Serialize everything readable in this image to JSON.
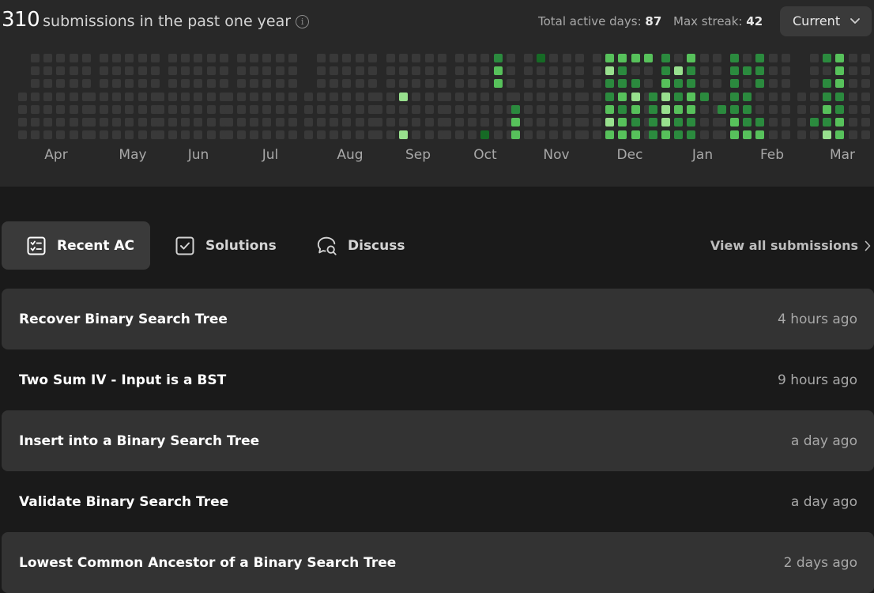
{
  "stats": {
    "count": "310",
    "count_label": "submissions in the past one year",
    "total_active_label": "Total active days:",
    "total_active_value": "87",
    "max_streak_label": "Max streak:",
    "max_streak_value": "42",
    "period_select": "Current"
  },
  "heatmap": {
    "months": [
      "Apr",
      "May",
      "Jun",
      "Jul",
      "Aug",
      "Sep",
      "Oct",
      "Nov",
      "Dec",
      "Jan",
      "Feb",
      "Mar"
    ],
    "colors": {
      "empty": "#393939",
      "level1": "#166a25",
      "level2": "#2b8a3e",
      "level3": "#57c15b",
      "level4": "#98e08e"
    },
    "active_cells": [
      {
        "month": "Sep",
        "week": 2,
        "day": 3,
        "level": 4
      },
      {
        "month": "Sep",
        "week": 2,
        "day": 6,
        "level": 4
      },
      {
        "month": "Oct",
        "week": 0,
        "day": 1,
        "level": 4
      },
      {
        "month": "Oct",
        "week": 0,
        "day": 2,
        "level": 4
      },
      {
        "month": "Oct",
        "week": 3,
        "day": 6,
        "level": 1
      },
      {
        "month": "Oct",
        "week": 4,
        "day": 0,
        "level": 2
      },
      {
        "month": "Oct",
        "week": 4,
        "day": 1,
        "level": 3
      },
      {
        "month": "Oct",
        "week": 4,
        "day": 2,
        "level": 3
      },
      {
        "month": "Nov",
        "week": 0,
        "day": 4,
        "level": 2
      },
      {
        "month": "Nov",
        "week": 0,
        "day": 5,
        "level": 3
      },
      {
        "month": "Nov",
        "week": 0,
        "day": 6,
        "level": 3
      },
      {
        "month": "Nov",
        "week": 2,
        "day": 0,
        "level": 1
      },
      {
        "month": "Dec",
        "week": 2,
        "day": 0,
        "level": 3
      },
      {
        "month": "Dec",
        "week": 2,
        "day": 1,
        "level": 4
      },
      {
        "month": "Dec",
        "week": 2,
        "day": 2,
        "level": 2
      },
      {
        "month": "Dec",
        "week": 2,
        "day": 3,
        "level": 2
      },
      {
        "month": "Dec",
        "week": 2,
        "day": 4,
        "level": 3
      },
      {
        "month": "Dec",
        "week": 2,
        "day": 5,
        "level": 4
      },
      {
        "month": "Dec",
        "week": 2,
        "day": 6,
        "level": 3
      },
      {
        "month": "Dec",
        "week": 3,
        "day": 0,
        "level": 3
      },
      {
        "month": "Dec",
        "week": 3,
        "day": 1,
        "level": 2
      },
      {
        "month": "Dec",
        "week": 3,
        "day": 2,
        "level": 2
      },
      {
        "month": "Dec",
        "week": 3,
        "day": 3,
        "level": 3
      },
      {
        "month": "Dec",
        "week": 3,
        "day": 4,
        "level": 2
      },
      {
        "month": "Dec",
        "week": 3,
        "day": 5,
        "level": 3
      },
      {
        "month": "Dec",
        "week": 3,
        "day": 6,
        "level": 3
      },
      {
        "month": "Dec",
        "week": 4,
        "day": 0,
        "level": 3
      },
      {
        "month": "Dec",
        "week": 4,
        "day": 2,
        "level": 2
      },
      {
        "month": "Dec",
        "week": 4,
        "day": 3,
        "level": 4
      },
      {
        "month": "Dec",
        "week": 4,
        "day": 4,
        "level": 3
      },
      {
        "month": "Dec",
        "week": 4,
        "day": 5,
        "level": 2
      },
      {
        "month": "Dec",
        "week": 4,
        "day": 6,
        "level": 3
      },
      {
        "month": "Dec",
        "week": 5,
        "day": 0,
        "level": 3
      },
      {
        "month": "Jan",
        "week": 0,
        "day": 2,
        "level": 3
      },
      {
        "month": "Jan",
        "week": 0,
        "day": 3,
        "level": 2
      },
      {
        "month": "Jan",
        "week": 0,
        "day": 4,
        "level": 2
      },
      {
        "month": "Jan",
        "week": 0,
        "day": 5,
        "level": 2
      },
      {
        "month": "Jan",
        "week": 0,
        "day": 6,
        "level": 2
      },
      {
        "month": "Jan",
        "week": 1,
        "day": 0,
        "level": 2
      },
      {
        "month": "Jan",
        "week": 1,
        "day": 1,
        "level": 2
      },
      {
        "month": "Jan",
        "week": 1,
        "day": 2,
        "level": 3
      },
      {
        "month": "Jan",
        "week": 1,
        "day": 3,
        "level": 4
      },
      {
        "month": "Jan",
        "week": 1,
        "day": 4,
        "level": 4
      },
      {
        "month": "Jan",
        "week": 1,
        "day": 5,
        "level": 4
      },
      {
        "month": "Jan",
        "week": 1,
        "day": 6,
        "level": 3
      },
      {
        "month": "Jan",
        "week": 2,
        "day": 1,
        "level": 4
      },
      {
        "month": "Jan",
        "week": 2,
        "day": 2,
        "level": 2
      },
      {
        "month": "Jan",
        "week": 2,
        "day": 3,
        "level": 2
      },
      {
        "month": "Jan",
        "week": 2,
        "day": 4,
        "level": 3
      },
      {
        "month": "Jan",
        "week": 2,
        "day": 5,
        "level": 2
      },
      {
        "month": "Jan",
        "week": 2,
        "day": 6,
        "level": 2
      },
      {
        "month": "Jan",
        "week": 3,
        "day": 0,
        "level": 3
      },
      {
        "month": "Jan",
        "week": 3,
        "day": 1,
        "level": 2
      },
      {
        "month": "Jan",
        "week": 3,
        "day": 2,
        "level": 2
      },
      {
        "month": "Jan",
        "week": 3,
        "day": 3,
        "level": 3
      },
      {
        "month": "Jan",
        "week": 3,
        "day": 4,
        "level": 3
      },
      {
        "month": "Jan",
        "week": 3,
        "day": 5,
        "level": 2
      },
      {
        "month": "Jan",
        "week": 3,
        "day": 6,
        "level": 2
      },
      {
        "month": "Jan",
        "week": 4,
        "day": 3,
        "level": 2
      },
      {
        "month": "Feb",
        "week": 0,
        "day": 4,
        "level": 2
      },
      {
        "month": "Feb",
        "week": 1,
        "day": 0,
        "level": 2
      },
      {
        "month": "Feb",
        "week": 1,
        "day": 1,
        "level": 2
      },
      {
        "month": "Feb",
        "week": 1,
        "day": 2,
        "level": 2
      },
      {
        "month": "Feb",
        "week": 1,
        "day": 3,
        "level": 2
      },
      {
        "month": "Feb",
        "week": 1,
        "day": 4,
        "level": 2
      },
      {
        "month": "Feb",
        "week": 1,
        "day": 5,
        "level": 3
      },
      {
        "month": "Feb",
        "week": 1,
        "day": 6,
        "level": 3
      },
      {
        "month": "Feb",
        "week": 2,
        "day": 1,
        "level": 2
      },
      {
        "month": "Feb",
        "week": 2,
        "day": 3,
        "level": 2
      },
      {
        "month": "Feb",
        "week": 2,
        "day": 4,
        "level": 2
      },
      {
        "month": "Feb",
        "week": 2,
        "day": 5,
        "level": 2
      },
      {
        "month": "Feb",
        "week": 2,
        "day": 6,
        "level": 3
      },
      {
        "month": "Feb",
        "week": 3,
        "day": 0,
        "level": 2
      },
      {
        "month": "Feb",
        "week": 3,
        "day": 1,
        "level": 2
      },
      {
        "month": "Feb",
        "week": 3,
        "day": 2,
        "level": 2
      },
      {
        "month": "Feb",
        "week": 3,
        "day": 5,
        "level": 2
      },
      {
        "month": "Feb",
        "week": 3,
        "day": 6,
        "level": 3
      },
      {
        "month": "Mar",
        "week": 1,
        "day": 5,
        "level": 2
      },
      {
        "month": "Mar",
        "week": 2,
        "day": 0,
        "level": 2
      },
      {
        "month": "Mar",
        "week": 2,
        "day": 2,
        "level": 2
      },
      {
        "month": "Mar",
        "week": 2,
        "day": 3,
        "level": 2
      },
      {
        "month": "Mar",
        "week": 2,
        "day": 4,
        "level": 3
      },
      {
        "month": "Mar",
        "week": 2,
        "day": 5,
        "level": 2
      },
      {
        "month": "Mar",
        "week": 2,
        "day": 6,
        "level": 4
      },
      {
        "month": "Mar",
        "week": 3,
        "day": 0,
        "level": 3
      },
      {
        "month": "Mar",
        "week": 3,
        "day": 1,
        "level": 3
      },
      {
        "month": "Mar",
        "week": 3,
        "day": 2,
        "level": 3
      },
      {
        "month": "Mar",
        "week": 3,
        "day": 3,
        "level": 2
      },
      {
        "month": "Mar",
        "week": 3,
        "day": 4,
        "level": 2
      },
      {
        "month": "Mar",
        "week": 3,
        "day": 5,
        "level": 3
      },
      {
        "month": "Mar",
        "week": 3,
        "day": 6,
        "level": 3
      }
    ]
  },
  "tabs": [
    {
      "label": "Recent AC",
      "icon": "checklist-icon",
      "active": true
    },
    {
      "label": "Solutions",
      "icon": "checkbox-icon",
      "active": false
    },
    {
      "label": "Discuss",
      "icon": "discuss-icon",
      "active": false
    }
  ],
  "view_all": "View all submissions",
  "submissions": [
    {
      "title": "Recover Binary Search Tree",
      "time": "4 hours ago"
    },
    {
      "title": "Two Sum IV - Input is a BST",
      "time": "9 hours ago"
    },
    {
      "title": "Insert into a Binary Search Tree",
      "time": "a day ago"
    },
    {
      "title": "Validate Binary Search Tree",
      "time": "a day ago"
    },
    {
      "title": "Lowest Common Ancestor of a Binary Search Tree",
      "time": "2 days ago"
    }
  ]
}
